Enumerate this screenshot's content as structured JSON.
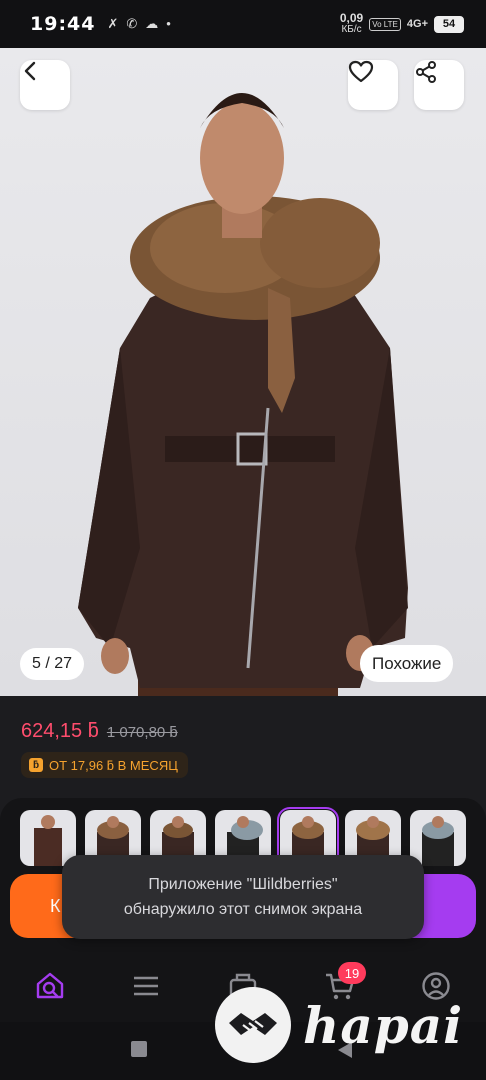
{
  "status_bar": {
    "time": "19:44",
    "speed_value": "0,09",
    "speed_unit": "КБ/с",
    "volte": "Vo LTE",
    "network": "4G+",
    "battery": "54"
  },
  "product_image": {
    "counter": "5 / 27",
    "similar_label": "Похожие"
  },
  "price": {
    "current": "624,15 ƃ",
    "old": "1 070,80 ƃ",
    "installment": "ОТ 17,96 ƃ В МЕСЯЦ"
  },
  "actions": {
    "cart_label": "К"
  },
  "toast": {
    "line1": "Приложение \"Шildberries\"",
    "line2": "обнаружило этот снимок экрана"
  },
  "bottom_nav": {
    "cart_badge": "19"
  },
  "watermark": {
    "text": "hapai"
  },
  "colors": {
    "price": "#ff4d6d",
    "accent_purple": "#a53cf0",
    "cart_orange": "#ff6a1a",
    "installment": "#f5a22e"
  }
}
